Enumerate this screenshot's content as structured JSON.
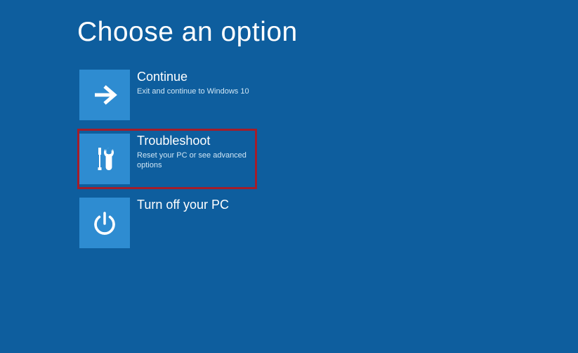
{
  "page": {
    "title": "Choose an option"
  },
  "options": {
    "continue": {
      "title": "Continue",
      "subtitle": "Exit and continue to Windows 10"
    },
    "troubleshoot": {
      "title": "Troubleshoot",
      "subtitle": "Reset your PC or see advanced options"
    },
    "turnoff": {
      "title": "Turn off your PC"
    }
  },
  "colors": {
    "background": "#0e5e9e",
    "tile": "#2e8cd1",
    "highlight_border": "#a31d2a"
  }
}
